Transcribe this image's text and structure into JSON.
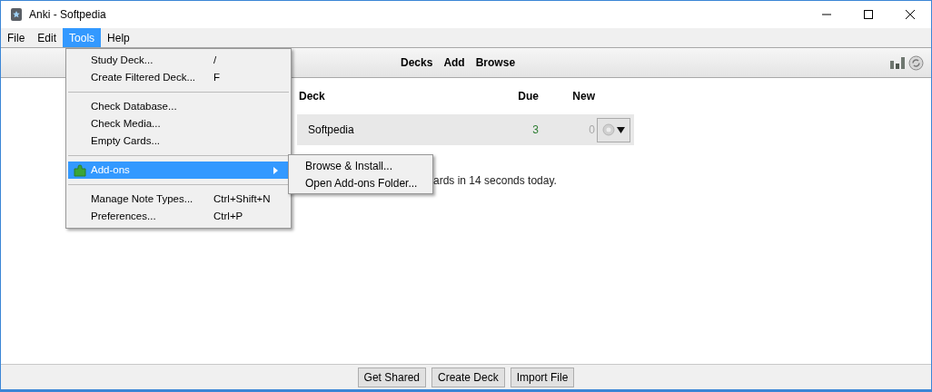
{
  "window": {
    "title": "Anki - Softpedia"
  },
  "menubar": [
    {
      "label": "File",
      "selected": false
    },
    {
      "label": "Edit",
      "selected": false
    },
    {
      "label": "Tools",
      "selected": true
    },
    {
      "label": "Help",
      "selected": false
    }
  ],
  "toolbar": [
    "Decks",
    "Add",
    "Browse"
  ],
  "deck_table": {
    "columns": [
      "Deck",
      "Due",
      "New"
    ],
    "rows": [
      {
        "deck": "Softpedia",
        "due": "3",
        "new": "0"
      }
    ]
  },
  "study_summary": "ards in 14 seconds today.",
  "tools_menu": [
    {
      "kind": "item",
      "label": "Study Deck...",
      "shortcut": "/"
    },
    {
      "kind": "item",
      "label": "Create Filtered Deck...",
      "shortcut": "F"
    },
    {
      "kind": "separator"
    },
    {
      "kind": "item",
      "label": "Check Database..."
    },
    {
      "kind": "item",
      "label": "Check Media..."
    },
    {
      "kind": "item",
      "label": "Empty Cards..."
    },
    {
      "kind": "separator"
    },
    {
      "kind": "submenu",
      "label": "Add-ons",
      "selected": true
    },
    {
      "kind": "separator"
    },
    {
      "kind": "item",
      "label": "Manage Note Types...",
      "shortcut": "Ctrl+Shift+N"
    },
    {
      "kind": "item",
      "label": "Preferences...",
      "shortcut": "Ctrl+P"
    }
  ],
  "addons_submenu": [
    "Browse & Install...",
    "Open Add-ons Folder..."
  ],
  "bottom_buttons": [
    "Get Shared",
    "Create Deck",
    "Import File"
  ]
}
